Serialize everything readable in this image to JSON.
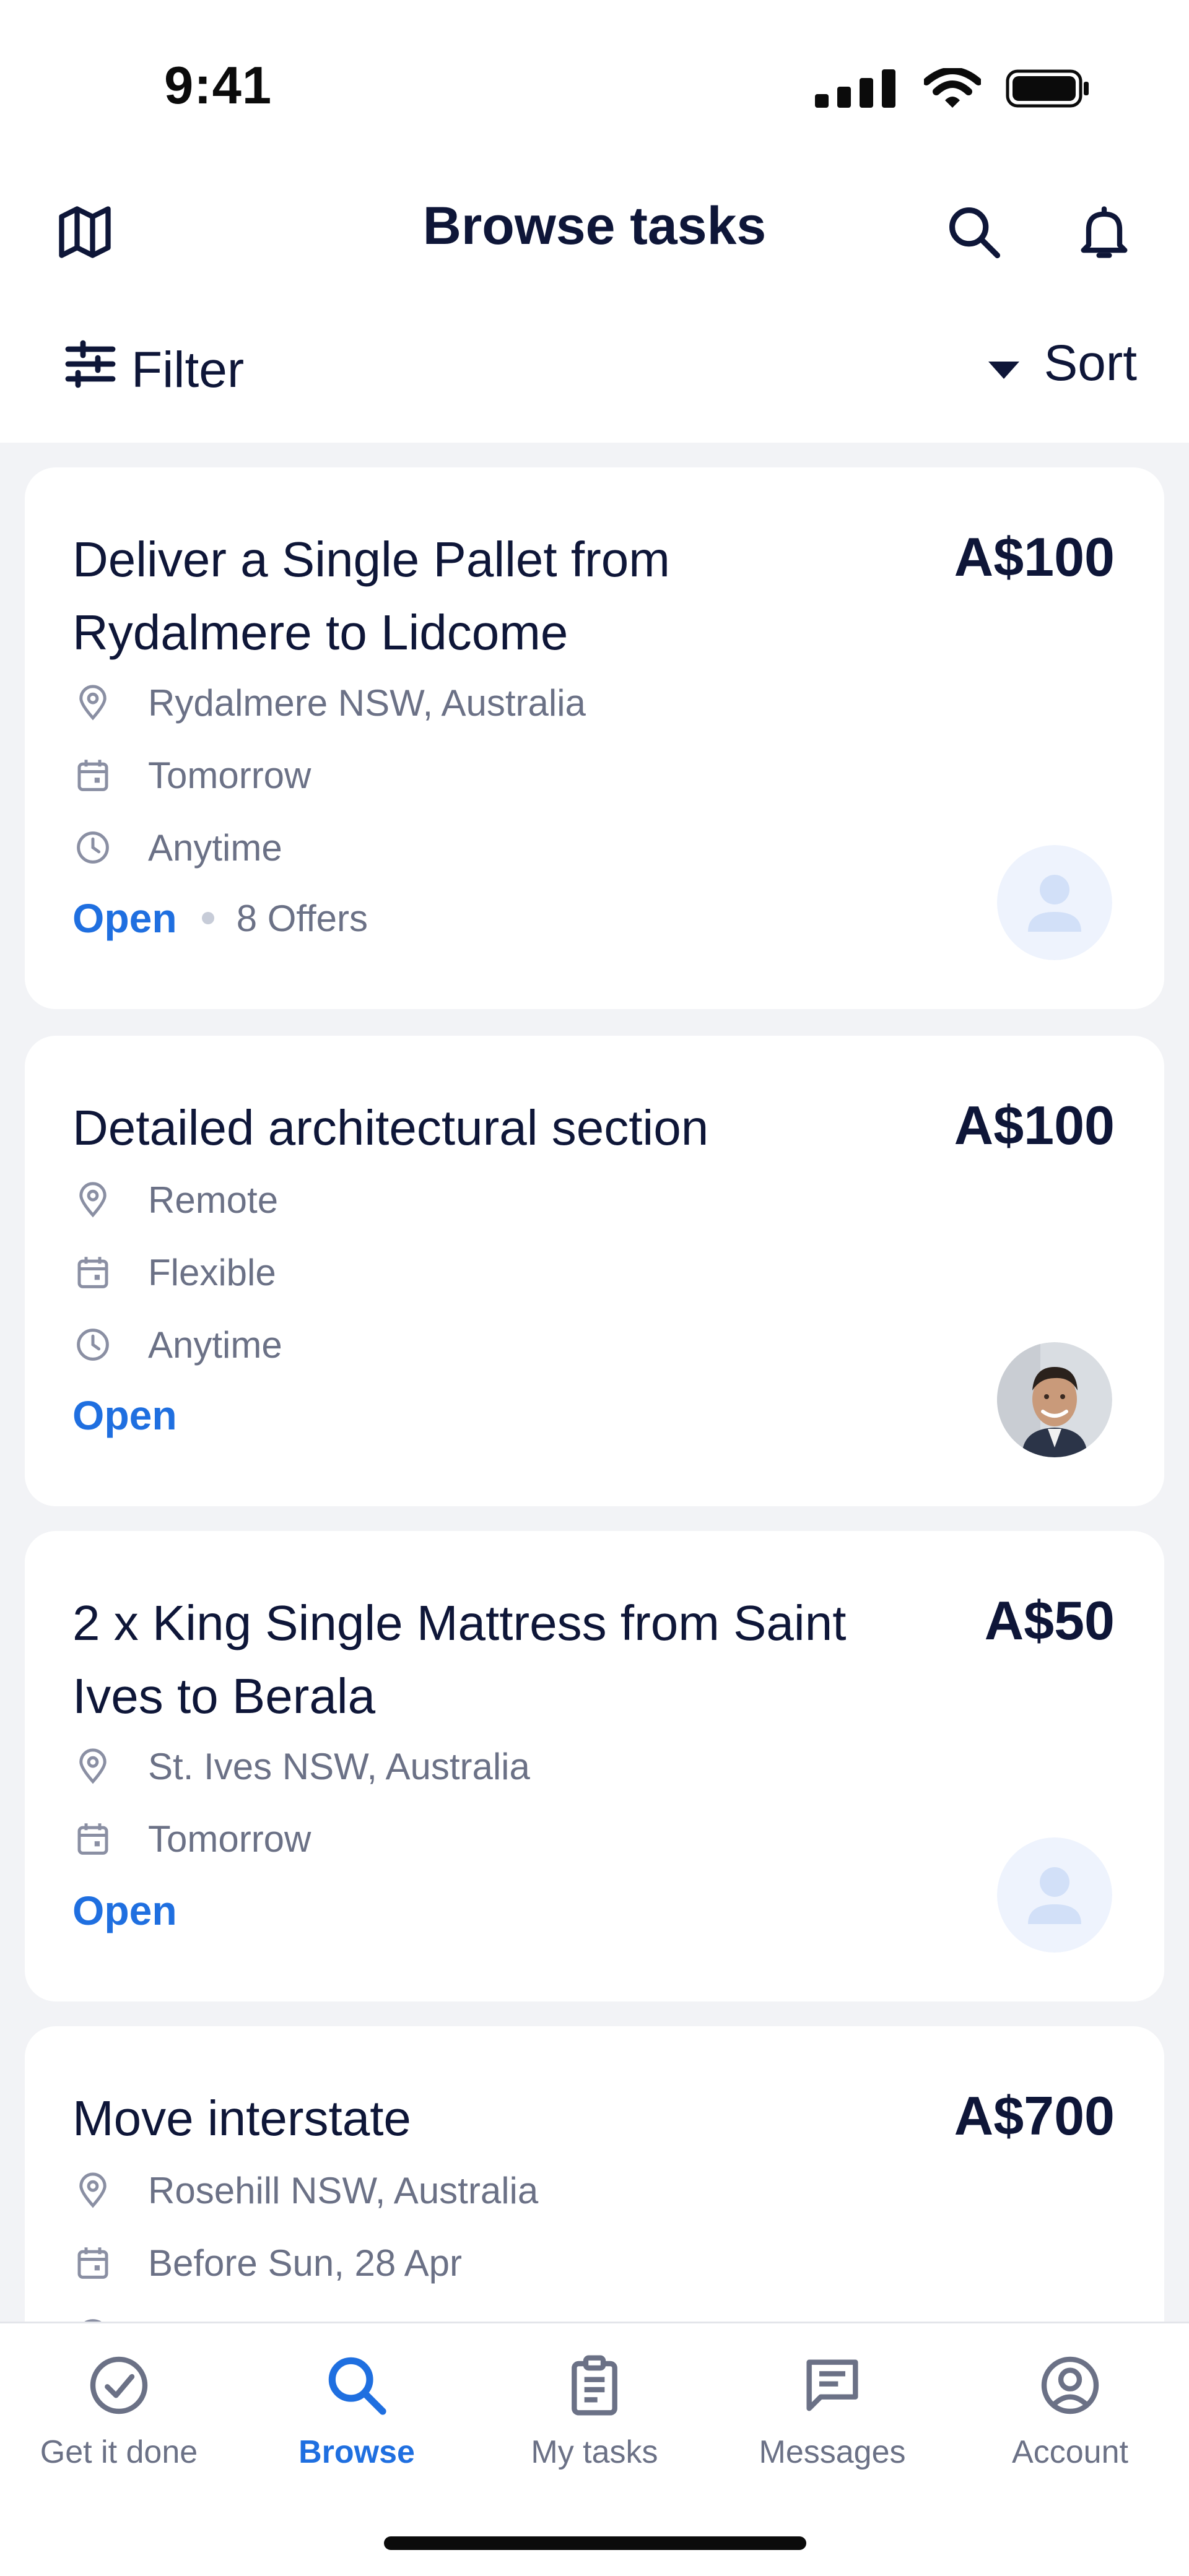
{
  "status_bar": {
    "time": "9:41"
  },
  "header": {
    "title": "Browse tasks"
  },
  "toolbar": {
    "filter_label": "Filter",
    "sort_label": "Sort"
  },
  "tasks": [
    {
      "title": "Deliver a Single Pallet from Rydalmere to Lidcome",
      "price": "A$100",
      "location": "Rydalmere NSW, Australia",
      "date": "Tomorrow",
      "time": "Anytime",
      "status": "Open",
      "offers": "8 Offers",
      "avatar": "placeholder"
    },
    {
      "title": "Detailed architectural section",
      "price": "A$100",
      "location": "Remote",
      "date": "Flexible",
      "time": "Anytime",
      "status": "Open",
      "avatar": "photo"
    },
    {
      "title": "2 x King Single Mattress from Saint Ives to Berala",
      "price": "A$50",
      "location": "St. Ives NSW, Australia",
      "date": "Tomorrow",
      "status": "Open",
      "avatar": "placeholder"
    },
    {
      "title": "Move interstate",
      "price": "A$700",
      "location": "Rosehill NSW, Australia",
      "date": "Before Sun, 28 Apr"
    }
  ],
  "nav": {
    "items": [
      {
        "label": "Get it done",
        "icon": "check-circle-icon"
      },
      {
        "label": "Browse",
        "icon": "search-icon",
        "active": true
      },
      {
        "label": "My tasks",
        "icon": "clipboard-icon"
      },
      {
        "label": "Messages",
        "icon": "message-icon"
      },
      {
        "label": "Account",
        "icon": "account-icon"
      }
    ]
  },
  "colors": {
    "primary": "#1f6fe0",
    "text": "#0e1638",
    "muted": "#6b7186",
    "list_bg": "#f2f3f6"
  }
}
